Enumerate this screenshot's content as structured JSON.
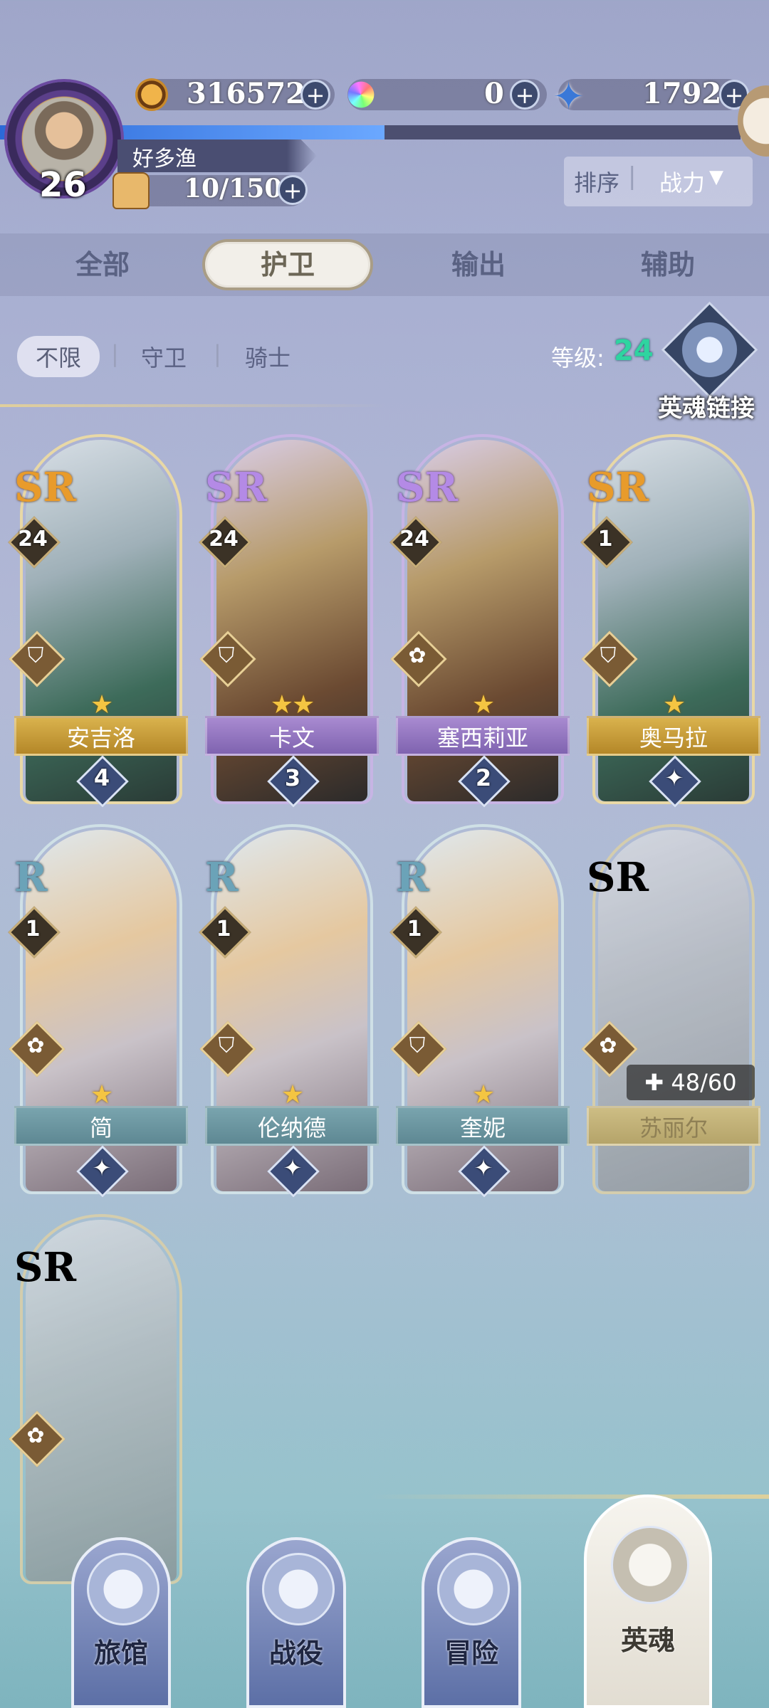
{
  "player": {
    "name": "好多渔",
    "level": "26",
    "stamina": "10/150",
    "exp_progress": 0.52
  },
  "resources": {
    "gold": "316572",
    "gems": "0",
    "crystals": "1792"
  },
  "sort": {
    "label": "排序",
    "value": "战力"
  },
  "tabs": [
    "全部",
    "护卫",
    "输出",
    "辅助"
  ],
  "active_tab": "护卫",
  "filters": [
    "不限",
    "守卫",
    "骑士"
  ],
  "level_filter": {
    "label": "等级:",
    "value": "24"
  },
  "soul_link": "英魂链接",
  "heroes": [
    {
      "name": "安吉洛",
      "rarity": "SR",
      "level": "24",
      "stars": "★",
      "rank": "4",
      "style": "gold",
      "class_icon": "shield-icon"
    },
    {
      "name": "卡文",
      "rarity": "SR",
      "level": "24",
      "stars": "★★",
      "rank": "3",
      "style": "purple",
      "class_icon": "shield-icon"
    },
    {
      "name": "塞西莉亚",
      "rarity": "SR",
      "level": "24",
      "stars": "★",
      "rank": "2",
      "style": "purple",
      "class_icon": "rose-icon"
    },
    {
      "name": "奥马拉",
      "rarity": "SR",
      "level": "1",
      "stars": "★",
      "rank": "",
      "style": "gold",
      "class_icon": "shield-icon"
    },
    {
      "name": "简",
      "rarity": "R",
      "level": "1",
      "stars": "★",
      "rank": "",
      "style": "teal",
      "class_icon": "rose-icon"
    },
    {
      "name": "伦纳德",
      "rarity": "R",
      "level": "1",
      "stars": "★",
      "rank": "",
      "style": "teal",
      "class_icon": "shield-icon"
    },
    {
      "name": "奎妮",
      "rarity": "R",
      "level": "1",
      "stars": "★",
      "rank": "",
      "style": "teal",
      "class_icon": "shield-icon"
    },
    {
      "name": "苏丽尔",
      "rarity": "SR",
      "level": "",
      "stars": "",
      "rank": "",
      "style": "locked",
      "class_icon": "rose-icon",
      "shards": "48/60"
    },
    {
      "name": "",
      "rarity": "SR",
      "level": "",
      "stars": "",
      "rank": "",
      "style": "locked",
      "class_icon": "rose-icon"
    }
  ],
  "nav": [
    "旅馆",
    "战役",
    "冒险",
    "英魂"
  ],
  "active_nav": "英魂",
  "colors": {
    "accent_gold": "#d9b24d",
    "accent_purple": "#a88ad0",
    "accent_teal": "#79a4ae",
    "level_green": "#2fd4a0"
  }
}
